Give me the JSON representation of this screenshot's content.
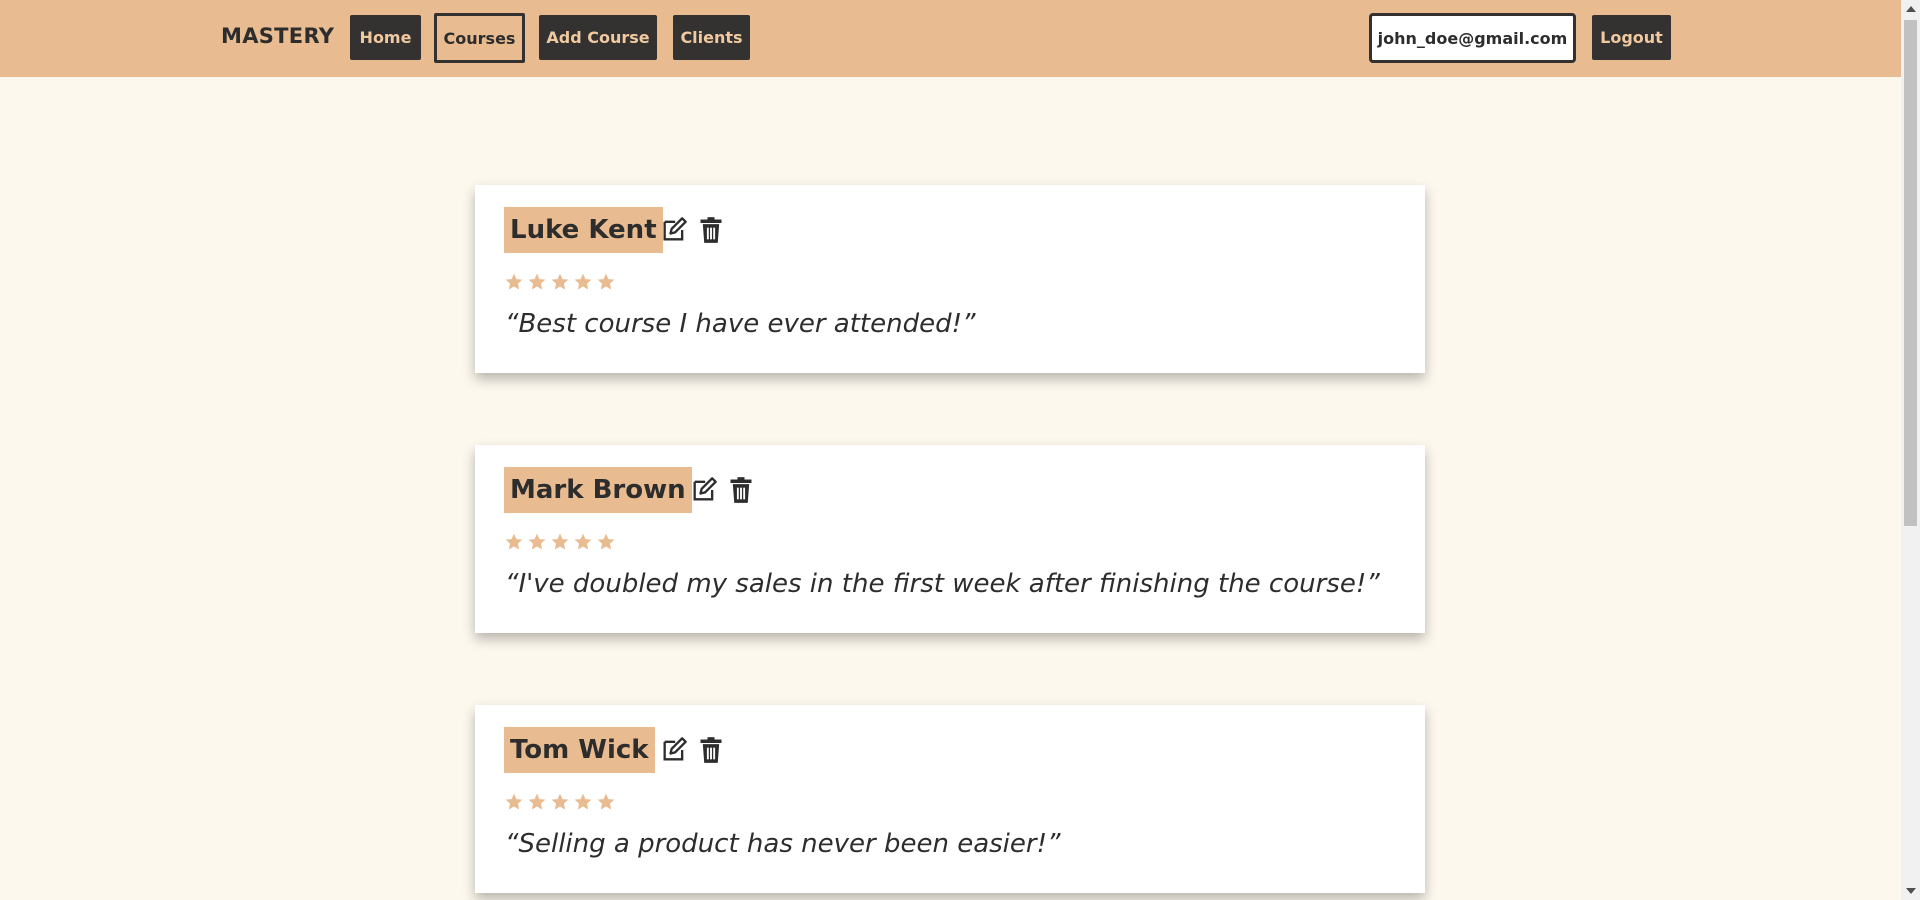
{
  "nav": {
    "brand": "MASTERY",
    "links": [
      {
        "label": "Home"
      },
      {
        "label": "Courses",
        "active": true
      },
      {
        "label": "Add Course"
      },
      {
        "label": "Clients"
      }
    ],
    "user_email": "john_doe@gmail.com",
    "logout_label": "Logout"
  },
  "testimonials": [
    {
      "name": "Luke Kent",
      "rating": 5,
      "max_rating": 5,
      "quote": "“Best course I have ever attended!”"
    },
    {
      "name": "Mark Brown",
      "rating": 5,
      "max_rating": 5,
      "quote": "“I've doubled my sales in the first week after finishing the course!”"
    },
    {
      "name": "Tom Wick",
      "rating": 5,
      "max_rating": 5,
      "quote": "“Selling a product has never been easier!”"
    }
  ],
  "icons": {
    "edit": "edit-icon",
    "delete": "trash-icon",
    "star": "star-icon"
  },
  "colors": {
    "accent": "#e8bb90",
    "dark": "#333231",
    "background": "#fdf8ee"
  }
}
